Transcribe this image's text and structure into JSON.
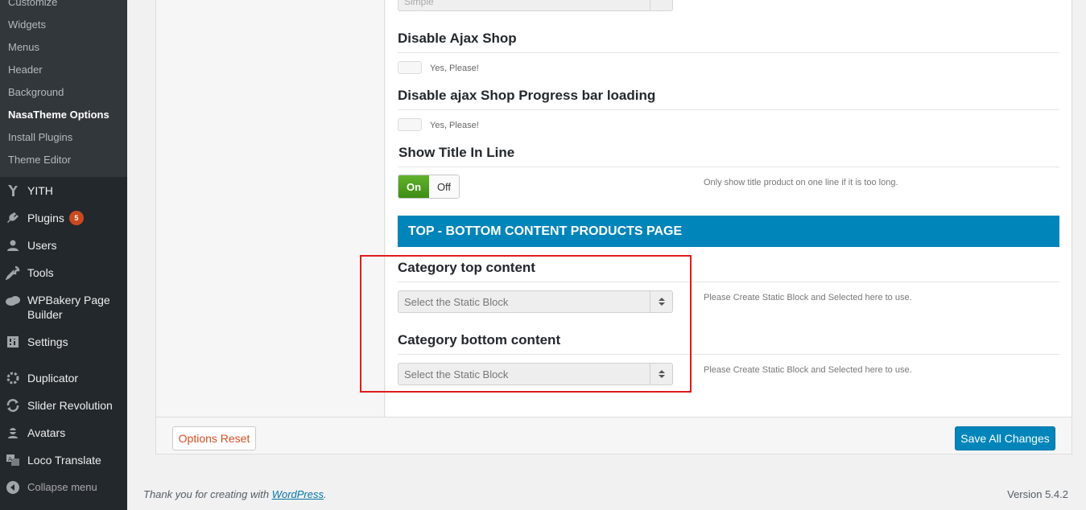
{
  "sidebar": {
    "submenu": [
      {
        "label": "Customize",
        "current": false
      },
      {
        "label": "Widgets",
        "current": false
      },
      {
        "label": "Menus",
        "current": false
      },
      {
        "label": "Header",
        "current": false
      },
      {
        "label": "Background",
        "current": false
      },
      {
        "label": "NasaTheme Options",
        "current": true
      },
      {
        "label": "Install Plugins",
        "current": false
      },
      {
        "label": "Theme Editor",
        "current": false
      }
    ],
    "menu": [
      {
        "label": "YITH",
        "icon": "yith-icon"
      },
      {
        "label": "Plugins",
        "icon": "plugins-icon",
        "badge": "5"
      },
      {
        "label": "Users",
        "icon": "users-icon"
      },
      {
        "label": "Tools",
        "icon": "tools-icon"
      },
      {
        "label": "WPBakery Page Builder",
        "icon": "wpbakery-icon"
      },
      {
        "label": "Settings",
        "icon": "settings-icon"
      },
      {
        "label": "Duplicator",
        "icon": "duplicator-icon"
      },
      {
        "label": "Slider Revolution",
        "icon": "slider-revolution-icon"
      },
      {
        "label": "Avatars",
        "icon": "avatars-icon"
      },
      {
        "label": "Loco Translate",
        "icon": "loco-translate-icon"
      }
    ],
    "collapse_label": "Collapse menu"
  },
  "options": {
    "partial_select_value": "Simple",
    "disable_ajax_shop": {
      "title": "Disable Ajax Shop",
      "checkbox_label": "Yes, Please!",
      "checked": false
    },
    "disable_ajax_progress": {
      "title": "Disable ajax Shop Progress bar loading",
      "checkbox_label": "Yes, Please!",
      "checked": false
    },
    "show_title_in_line": {
      "title": "Show Title In Line",
      "on_label": "On",
      "off_label": "Off",
      "state": "On",
      "description": "Only show title product on one line if it is too long."
    },
    "section_heading": "TOP - BOTTOM CONTENT PRODUCTS PAGE",
    "category_top": {
      "title": "Category top content",
      "select_value": "Select the Static Block",
      "description": "Please Create Static Block and Selected here to use."
    },
    "category_bottom": {
      "title": "Category bottom content",
      "select_value": "Select the Static Block",
      "description": "Please Create Static Block and Selected here to use."
    }
  },
  "actions": {
    "reset_label": "Options Reset",
    "save_label": "Save All Changes"
  },
  "footer": {
    "thanks_prefix": "Thank you for creating with ",
    "thanks_link": "WordPress",
    "thanks_suffix": ".",
    "version": "Version 5.4.2"
  },
  "colors": {
    "sidebar_bg": "#23282d",
    "submenu_bg": "#32373c",
    "accent": "#0085ba",
    "switch_on": "#4a9e1f",
    "reset_text": "#d54e21",
    "highlight": "#e01b1b",
    "badge": "#ca4a1f"
  }
}
